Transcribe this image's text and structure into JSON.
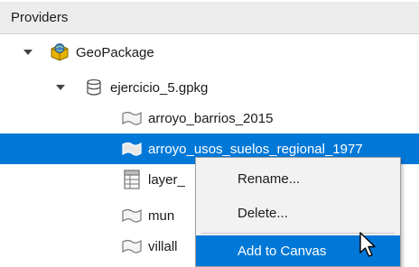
{
  "panel": {
    "title": "Providers"
  },
  "tree": {
    "geopackage": {
      "label": "GeoPackage",
      "icon": "geopackage-icon"
    },
    "database": {
      "label": "ejercicio_5.gpkg",
      "icon": "database-icon"
    },
    "layers": [
      {
        "label": "arroyo_barrios_2015",
        "icon": "polygon-layer-icon"
      },
      {
        "label": "arroyo_usos_suelos_regional_1977",
        "icon": "polygon-layer-icon",
        "selected": true
      },
      {
        "label": "layer_",
        "icon": "table-layer-icon"
      },
      {
        "label": "mun",
        "icon": "polygon-layer-icon"
      },
      {
        "label": "villall",
        "icon": "polygon-layer-icon"
      }
    ]
  },
  "context_menu": {
    "items": [
      {
        "label": "Rename..."
      },
      {
        "label": "Delete..."
      },
      {
        "label": "Add to Canvas",
        "active": true
      }
    ]
  },
  "colors": {
    "selection": "#0078d7",
    "menu_bg": "#f2f2f2",
    "header_bg": "#ececec"
  }
}
